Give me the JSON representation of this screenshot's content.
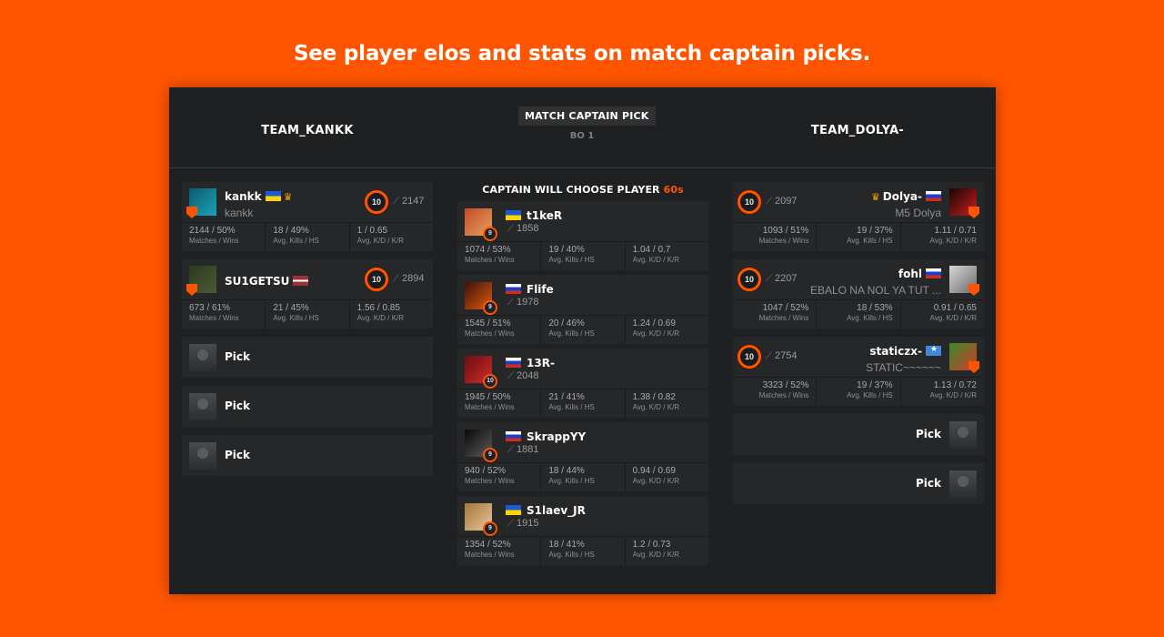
{
  "headline": "See player elos and stats on match captain picks.",
  "colors": {
    "background": "#ff5500",
    "panel": "#1f2021",
    "card": "#262728",
    "accent": "#ff5500"
  },
  "header": {
    "team_left": "TEAM_KANKK",
    "team_right": "TEAM_DOLYA-",
    "badge": "MATCH CAPTAIN PICK",
    "format": "BO 1"
  },
  "choose": {
    "text": "CAPTAIN WILL CHOOSE PLAYER ",
    "timer": "60s"
  },
  "stat_labels": {
    "matches": "Matches / Wins",
    "kills": "Avg. Kills / HS",
    "kd": "Avg. K/D / K/R"
  },
  "pick_label": "Pick",
  "left_team": [
    {
      "name": "kankk",
      "flag": "ua",
      "captain": true,
      "sub": "kankk",
      "level": "10",
      "elo": "2147",
      "matches": "2144 / 50%",
      "kills": "18 / 49%",
      "kd": "1 / 0.65"
    },
    {
      "name": "SU1GETSU",
      "flag": "lv",
      "captain": false,
      "sub": "",
      "level": "10",
      "elo": "2894",
      "matches": "673 / 61%",
      "kills": "21 / 45%",
      "kd": "1.56 / 0.85"
    }
  ],
  "right_team": [
    {
      "name": "Dolya-",
      "flag": "ru",
      "captain": true,
      "sub": "M5 Dolya",
      "level": "10",
      "elo": "2097",
      "matches": "1093 / 51%",
      "kills": "19 / 37%",
      "kd": "1.11 / 0.71"
    },
    {
      "name": "fohl",
      "flag": "ru",
      "captain": false,
      "sub": "EBALO NA NOL YA TUT ...",
      "level": "10",
      "elo": "2207",
      "matches": "1047 / 52%",
      "kills": "18 / 53%",
      "kd": "0.91 / 0.65"
    },
    {
      "name": "staticzx-",
      "flag": "so",
      "captain": false,
      "sub": "STATIC~~~~~~",
      "level": "10",
      "elo": "2754",
      "matches": "3323 / 52%",
      "kills": "19 / 37%",
      "kd": "1.13 / 0.72"
    }
  ],
  "pool": [
    {
      "name": "t1keR",
      "flag": "ua",
      "level": "9",
      "elo": "1858",
      "matches": "1074 / 53%",
      "kills": "19 / 40%",
      "kd": "1.04 / 0.7"
    },
    {
      "name": "Flife",
      "flag": "ru",
      "level": "9",
      "elo": "1978",
      "matches": "1545 / 51%",
      "kills": "20 / 46%",
      "kd": "1.24 / 0.69"
    },
    {
      "name": "13R-",
      "flag": "ru",
      "level": "10",
      "elo": "2048",
      "matches": "1945 / 50%",
      "kills": "21 / 41%",
      "kd": "1.38 / 0.82"
    },
    {
      "name": "SkrappYY",
      "flag": "ru",
      "level": "9",
      "elo": "1881",
      "matches": "940 / 52%",
      "kills": "18 / 44%",
      "kd": "0.94 / 0.69"
    },
    {
      "name": "S1laev_JR",
      "flag": "ua",
      "level": "9",
      "elo": "1915",
      "matches": "1354 / 52%",
      "kills": "18 / 41%",
      "kd": "1.2 / 0.73"
    }
  ]
}
